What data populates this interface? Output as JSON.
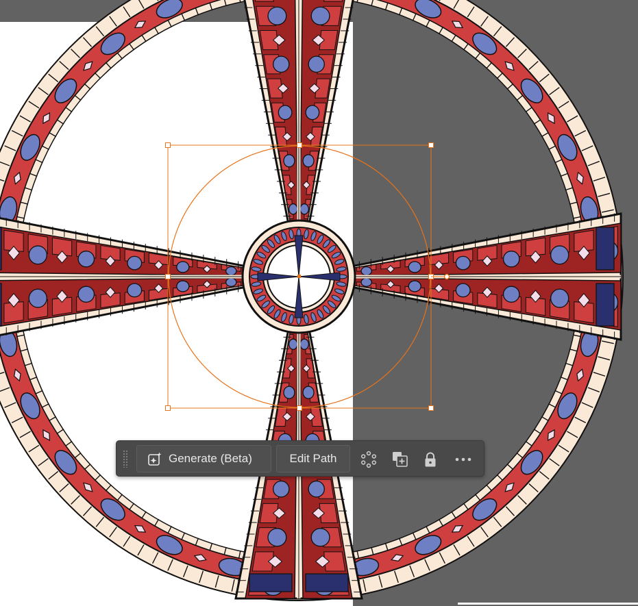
{
  "app": {
    "name": "Illustrator canvas with contextual task bar"
  },
  "colors": {
    "pasteboard": "#626262",
    "artboard": "#ffffff",
    "selection": "#e8731a",
    "band_red": "#cf3f3f",
    "band_dark_red": "#9e2424",
    "cream": "#fbe9d8",
    "oval_blue": "#6f7fc4",
    "navy": "#2a2f6e",
    "diamond_pink": "#f4dde8",
    "taskbar_bg": "#494949"
  },
  "taskbar": {
    "generate_label": "Generate (Beta)",
    "edit_path_label": "Edit Path",
    "icons": [
      "drag-grip-icon",
      "sparkle-generate-icon",
      "repeat-radial-icon",
      "duplicate-icon",
      "lock-icon",
      "more-options-icon"
    ]
  }
}
